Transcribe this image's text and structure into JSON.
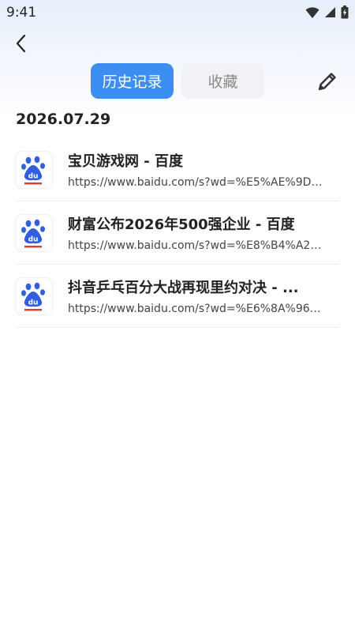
{
  "status_bar": {
    "time": "9:41",
    "icons": [
      "wifi-icon",
      "cellular-signal-icon",
      "battery-charging-icon"
    ]
  },
  "header": {
    "back_icon": "chevron-left-icon",
    "tabs": [
      {
        "label": "历史记录",
        "active": true
      },
      {
        "label": "收藏",
        "active": false
      }
    ],
    "edit_icon": "pencil-icon"
  },
  "colors": {
    "accent": "#3d8ef2",
    "inactive_tab_bg": "#f1f2f5",
    "inactive_tab_text": "#8a8a8a",
    "baidu_blue": "#2d5fe0",
    "baidu_red": "#e53935"
  },
  "history": {
    "date": "2026.07.29",
    "items": [
      {
        "icon": "baidu-paw-icon",
        "title": "宝贝游戏网 - 百度",
        "url": "https://www.baidu.com/s?wd=%E5%AE%9D%E8..."
      },
      {
        "icon": "baidu-paw-icon",
        "title": "财富公布2026年500强企业 - 百度",
        "url": "https://www.baidu.com/s?wd=%E8%B4%A2%E5..."
      },
      {
        "icon": "baidu-paw-icon",
        "title": "抖音乒乓百分大战再现里约对决 - ...",
        "url": "https://www.baidu.com/s?wd=%E6%8A%96%E9..."
      }
    ]
  }
}
